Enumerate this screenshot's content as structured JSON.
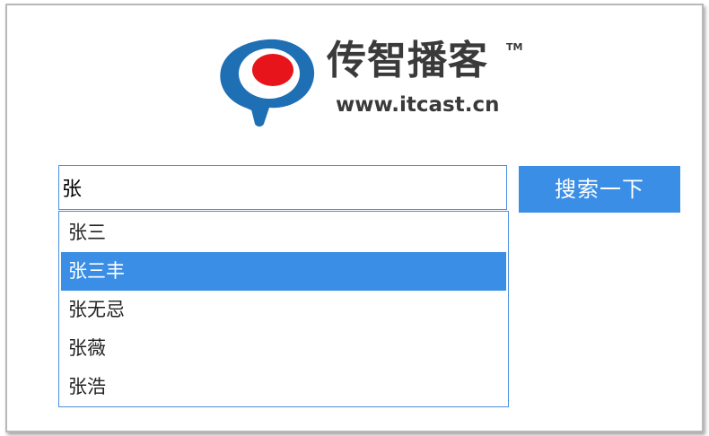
{
  "brand": {
    "name_cn": "传智播客",
    "tm": "TM",
    "url": "www.itcast.cn"
  },
  "search": {
    "value": "张",
    "button_label": "搜索一下"
  },
  "suggestions": [
    {
      "label": "张三",
      "active": false
    },
    {
      "label": "张三丰",
      "active": true
    },
    {
      "label": "张无忌",
      "active": false
    },
    {
      "label": "张薇",
      "active": false
    },
    {
      "label": "张浩",
      "active": false
    }
  ],
  "colors": {
    "accent": "#3a8ee6",
    "logo_blue": "#1f6fb5",
    "logo_red": "#e8141c",
    "text_dark": "#3a3a3a"
  },
  "icons": {
    "logo_mark": "itcast-logo-icon"
  }
}
